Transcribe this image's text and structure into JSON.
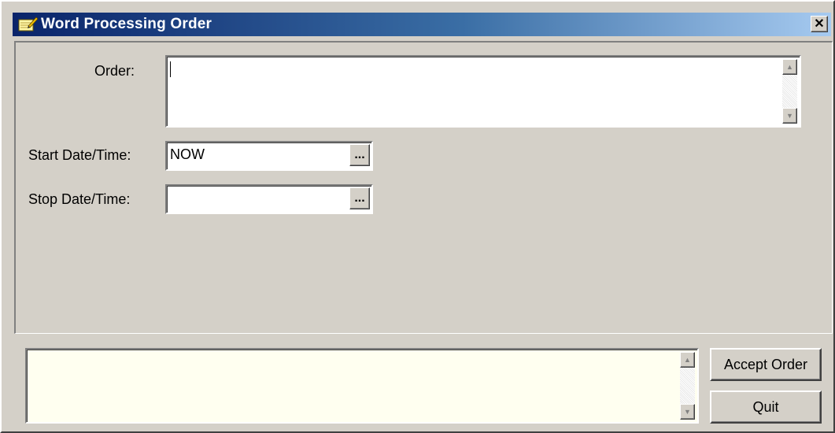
{
  "window": {
    "title": "Word Processing Order",
    "icon": "notepad-pencil-icon",
    "close_glyph": "✕"
  },
  "form": {
    "order_label": "Order:",
    "order_value": "",
    "start_label": "Start Date/Time:",
    "start_value": "NOW",
    "stop_label": "Stop Date/Time:",
    "stop_value": "",
    "ellipsis_glyph": "..."
  },
  "scroll": {
    "up_glyph": "▲",
    "down_glyph": "▼"
  },
  "footer": {
    "message_text": "",
    "accept_label": "Accept Order",
    "quit_label": "Quit"
  },
  "colors": {
    "face": "#d4d0c8",
    "title_start": "#0a246a",
    "title_end": "#a6caf0",
    "message_bg": "#fffff0"
  }
}
